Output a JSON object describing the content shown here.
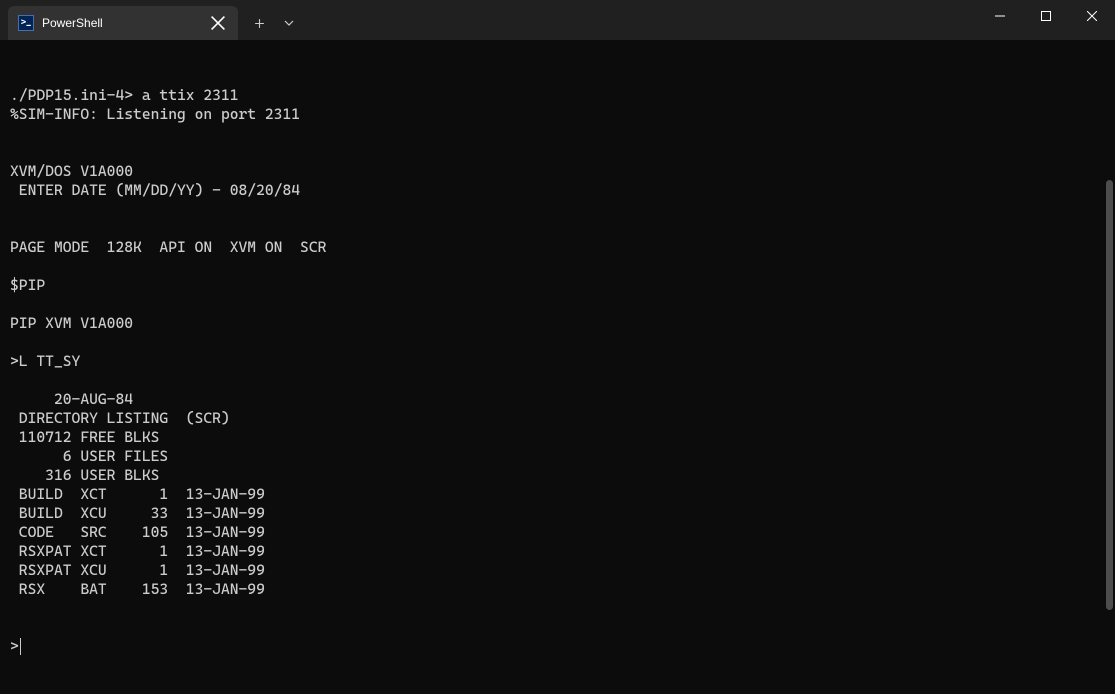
{
  "tab": {
    "title": "PowerShell",
    "icon_glyph": ">_"
  },
  "terminal": {
    "lines": [
      "./PDP15.ini-4> a ttix 2311",
      "%SIM-INFO: Listening on port 2311",
      "",
      "",
      "XVM/DOS V1A000",
      " ENTER DATE (MM/DD/YY) - 08/20/84",
      "",
      "",
      "PAGE MODE  128K  API ON  XVM ON  SCR",
      "",
      "$PIP",
      "",
      "PIP XVM V1A000",
      "",
      ">L TT_SY",
      "",
      "     20-AUG-84",
      " DIRECTORY LISTING  (SCR)",
      " 110712 FREE BLKS",
      "      6 USER FILES",
      "    316 USER BLKS",
      " BUILD  XCT      1  13-JAN-99",
      " BUILD  XCU     33  13-JAN-99",
      " CODE   SRC    105  13-JAN-99",
      " RSXPAT XCT      1  13-JAN-99",
      " RSXPAT XCU      1  13-JAN-99",
      " RSX    BAT    153  13-JAN-99",
      "",
      "",
      ">"
    ]
  }
}
